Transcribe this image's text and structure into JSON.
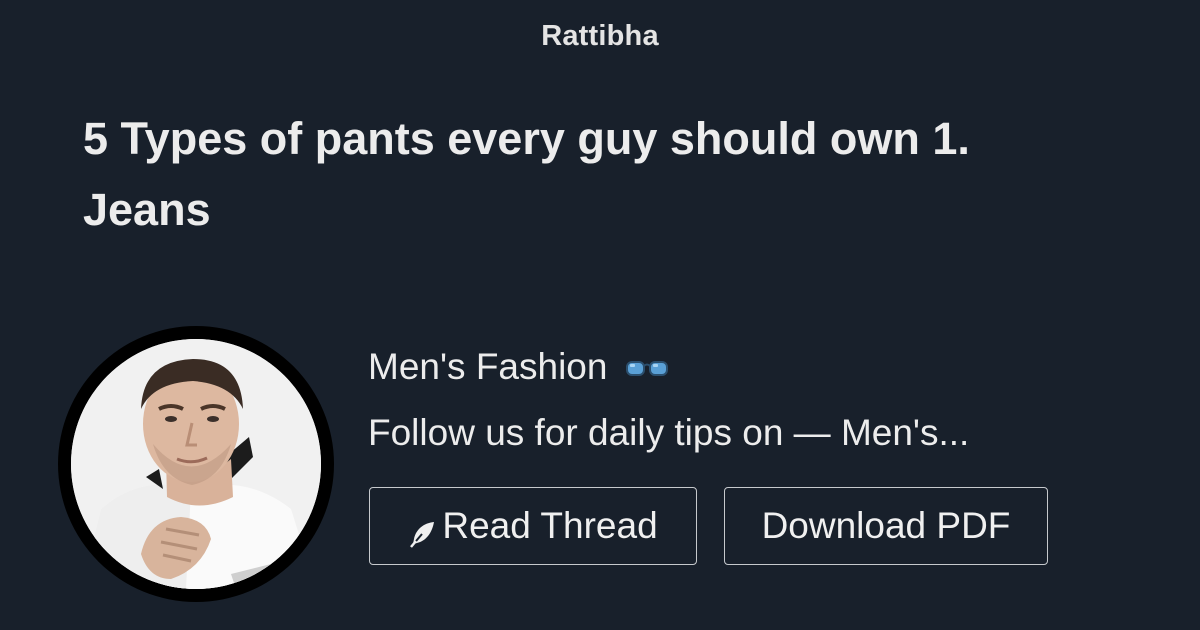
{
  "site": {
    "name": "Rattibha"
  },
  "thread": {
    "title": "5 Types of pants every guy should own 1. Jeans"
  },
  "author": {
    "name": "Men's Fashion",
    "name_icon": "glasses-icon",
    "bio": "Follow us for daily tips on — Men's...",
    "avatar_icon": "profile-photo"
  },
  "actions": {
    "read_thread_label": "Read Thread",
    "read_thread_icon": "feather-icon",
    "download_pdf_label": "Download PDF"
  },
  "colors": {
    "background": "#18202b",
    "text": "#ececec",
    "button_border": "#c6c9cd",
    "avatar_ring": "#000000"
  }
}
